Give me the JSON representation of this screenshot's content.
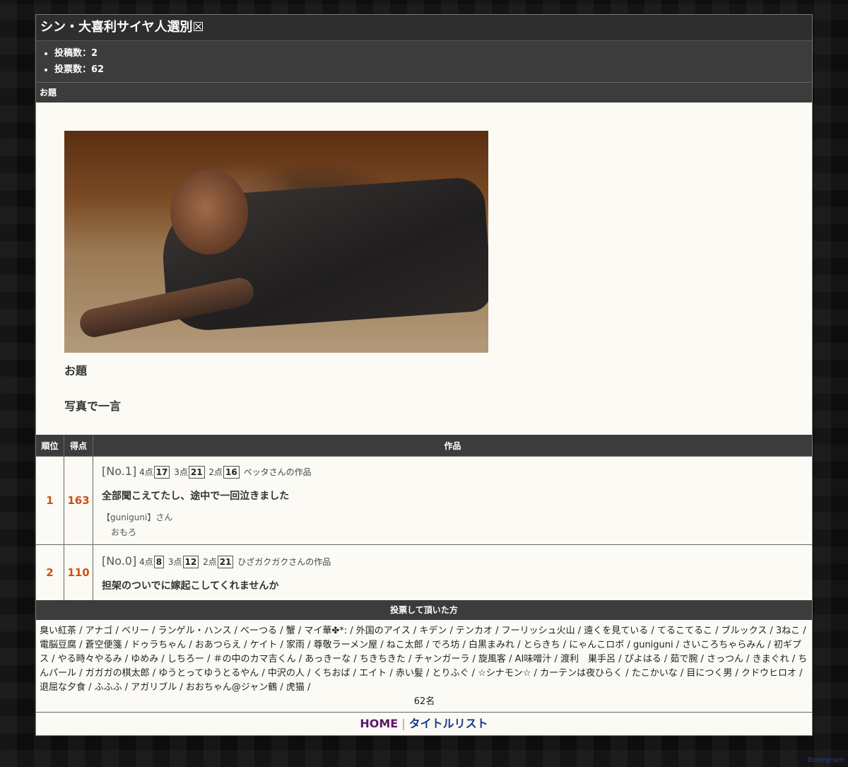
{
  "header": {
    "title": "シン・大喜利サイヤ人選別☒"
  },
  "stats": [
    {
      "label": "投稿数：2"
    },
    {
      "label": "投票数：62"
    }
  ],
  "odai_section": {
    "heading": "お題",
    "label": "お題",
    "text": "写真で一言"
  },
  "table": {
    "col_rank": "順位",
    "col_score": "得点",
    "col_work": "作品",
    "rows": [
      {
        "rank": "1",
        "score": "163",
        "no": "[No.1]",
        "p4_label": "4点",
        "p4": "17",
        "p3_label": "3点",
        "p3": "21",
        "p2_label": "2点",
        "p2": "16",
        "author": "ペッタさんの作品",
        "text": "全部聞こえてたし、途中で一回泣きました",
        "comment_user": "【guniguni】さん",
        "comment_text": "おもろ"
      },
      {
        "rank": "2",
        "score": "110",
        "no": "[No.0]",
        "p4_label": "4点",
        "p4": "8",
        "p3_label": "3点",
        "p3": "12",
        "p2_label": "2点",
        "p2": "21",
        "author": "ひざガクガクさんの作品",
        "text": "担架のついでに嫁起こしてくれませんか"
      }
    ]
  },
  "voters": {
    "heading": "投票して頂いた方",
    "list": "臭い紅茶 / アナゴ / ベリー / ランゲル・ハンス / べーつる / 蟹 / マイ華✤*: / 外国のアイス / キデン / テンカオ / フーリッシュ火山 / 遠くを見ている / てるこてるこ / ブルックス / 3ねこ / 電脳豆腐 / 蒼空便箋 / ドゥラちゃん / おあつらえ / ケイト / 家雨 / 尊敬ラーメン屋 / ねこ太郎 / でろ坊 / 白黒まみれ / とらきち / にゃんこロボ / guniguni / さいころちゃらみん / 初ギプス / やる時々やるみ / ゆめみ / しちろー / ＃の中のカマ吉くん / あっきーな / ちきちきた / チャンガーラ / 旋風客 / AI味噌汁 / 渡利　巣手呂 / ぴよはる / 茹で腕 / さっつん / きまぐれ / ちんパール / ガガガの棋太郎 / ゆうとってゆうとるやん / 中沢の人 / くちおば / エイト / 赤い髪 / とりふぐ / ☆シナモン☆ / カーテンは夜ひらく / たこかいな / 目につく男 / クドウヒロオ / 退屈な夕食 / ふふふ / アガリブル / おおちゃん@ジャン鶴 / 虎猫 /",
    "count": "62名"
  },
  "footer": {
    "home": "HOME",
    "separator": "|",
    "title_list": "タイトルリスト"
  },
  "credit": "Bokegram"
}
